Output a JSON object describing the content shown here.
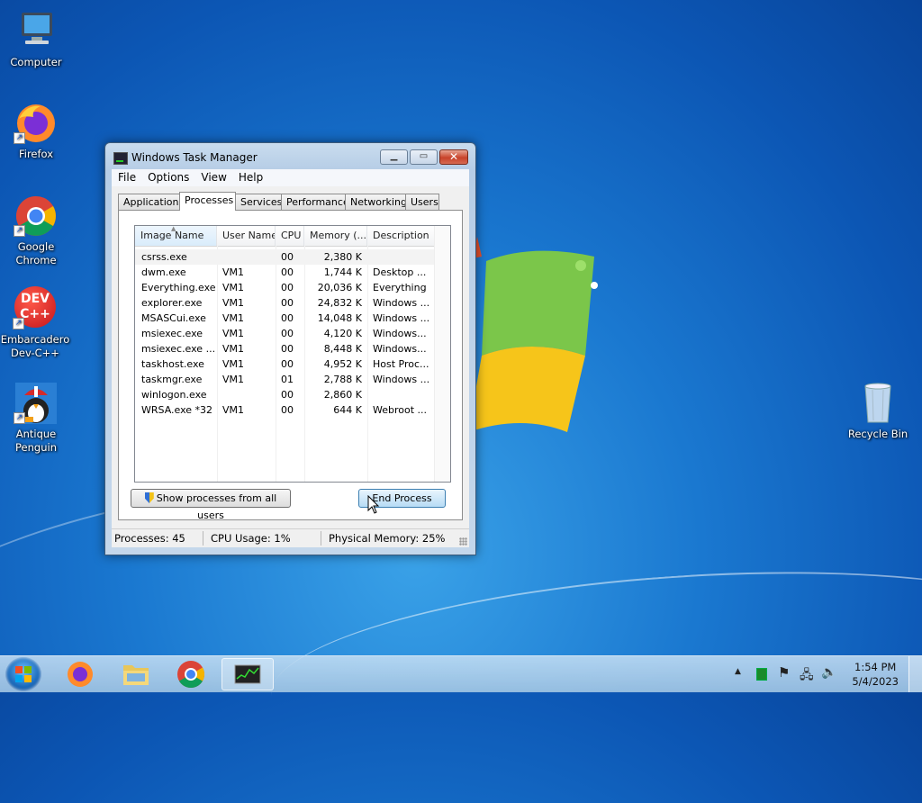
{
  "desktop": {
    "icons": [
      {
        "label": "Computer"
      },
      {
        "label": "Firefox"
      },
      {
        "label": "Google Chrome"
      },
      {
        "label": "Embarcadero Dev-C++",
        "logo_text": "DEV C++"
      },
      {
        "label": "Antique Penguin"
      },
      {
        "label": "Recycle Bin"
      }
    ]
  },
  "window": {
    "title": "Windows Task Manager",
    "controls": {
      "minimize": "▁",
      "maximize": "▭",
      "close": "✕"
    },
    "menu": [
      "File",
      "Options",
      "View",
      "Help"
    ],
    "tabs": [
      "Applications",
      "Processes",
      "Services",
      "Performance",
      "Networking",
      "Users"
    ],
    "active_tab": "Processes",
    "columns": [
      "Image Name",
      "User Name",
      "CPU",
      "Memory (...",
      "Description"
    ],
    "rows": [
      {
        "name": "csrss.exe",
        "user": "",
        "cpu": "00",
        "memory": "2,380 K",
        "desc": ""
      },
      {
        "name": "dwm.exe",
        "user": "VM1",
        "cpu": "00",
        "memory": "1,744 K",
        "desc": "Desktop ..."
      },
      {
        "name": "Everything.exe",
        "user": "VM1",
        "cpu": "00",
        "memory": "20,036 K",
        "desc": "Everything"
      },
      {
        "name": "explorer.exe",
        "user": "VM1",
        "cpu": "00",
        "memory": "24,832 K",
        "desc": "Windows ..."
      },
      {
        "name": "MSASCui.exe",
        "user": "VM1",
        "cpu": "00",
        "memory": "14,048 K",
        "desc": "Windows ..."
      },
      {
        "name": "msiexec.exe",
        "user": "VM1",
        "cpu": "00",
        "memory": "4,120 K",
        "desc": "Windows..."
      },
      {
        "name": "msiexec.exe ...",
        "user": "VM1",
        "cpu": "00",
        "memory": "8,448 K",
        "desc": "Windows..."
      },
      {
        "name": "taskhost.exe",
        "user": "VM1",
        "cpu": "00",
        "memory": "4,952 K",
        "desc": "Host Proc..."
      },
      {
        "name": "taskmgr.exe",
        "user": "VM1",
        "cpu": "01",
        "memory": "2,788 K",
        "desc": "Windows ..."
      },
      {
        "name": "winlogon.exe",
        "user": "",
        "cpu": "00",
        "memory": "2,860 K",
        "desc": ""
      },
      {
        "name": "WRSA.exe *32",
        "user": "VM1",
        "cpu": "00",
        "memory": "644 K",
        "desc": "Webroot ..."
      }
    ],
    "buttons": {
      "show_all": "Show processes from all users",
      "end_process": "End Process"
    },
    "status": {
      "processes": "Processes: 45",
      "cpu": "CPU Usage: 1%",
      "memory": "Physical Memory: 25%"
    }
  },
  "taskbar": {
    "pinned": [
      "start-button",
      "firefox",
      "explorer",
      "chrome",
      "task-manager"
    ],
    "clock_time": "1:54 PM",
    "clock_date": "5/4/2023"
  },
  "colors": {
    "desktop": "#1a78d0",
    "selection": "#f3f3f3",
    "accent": "#3c7fb1"
  }
}
